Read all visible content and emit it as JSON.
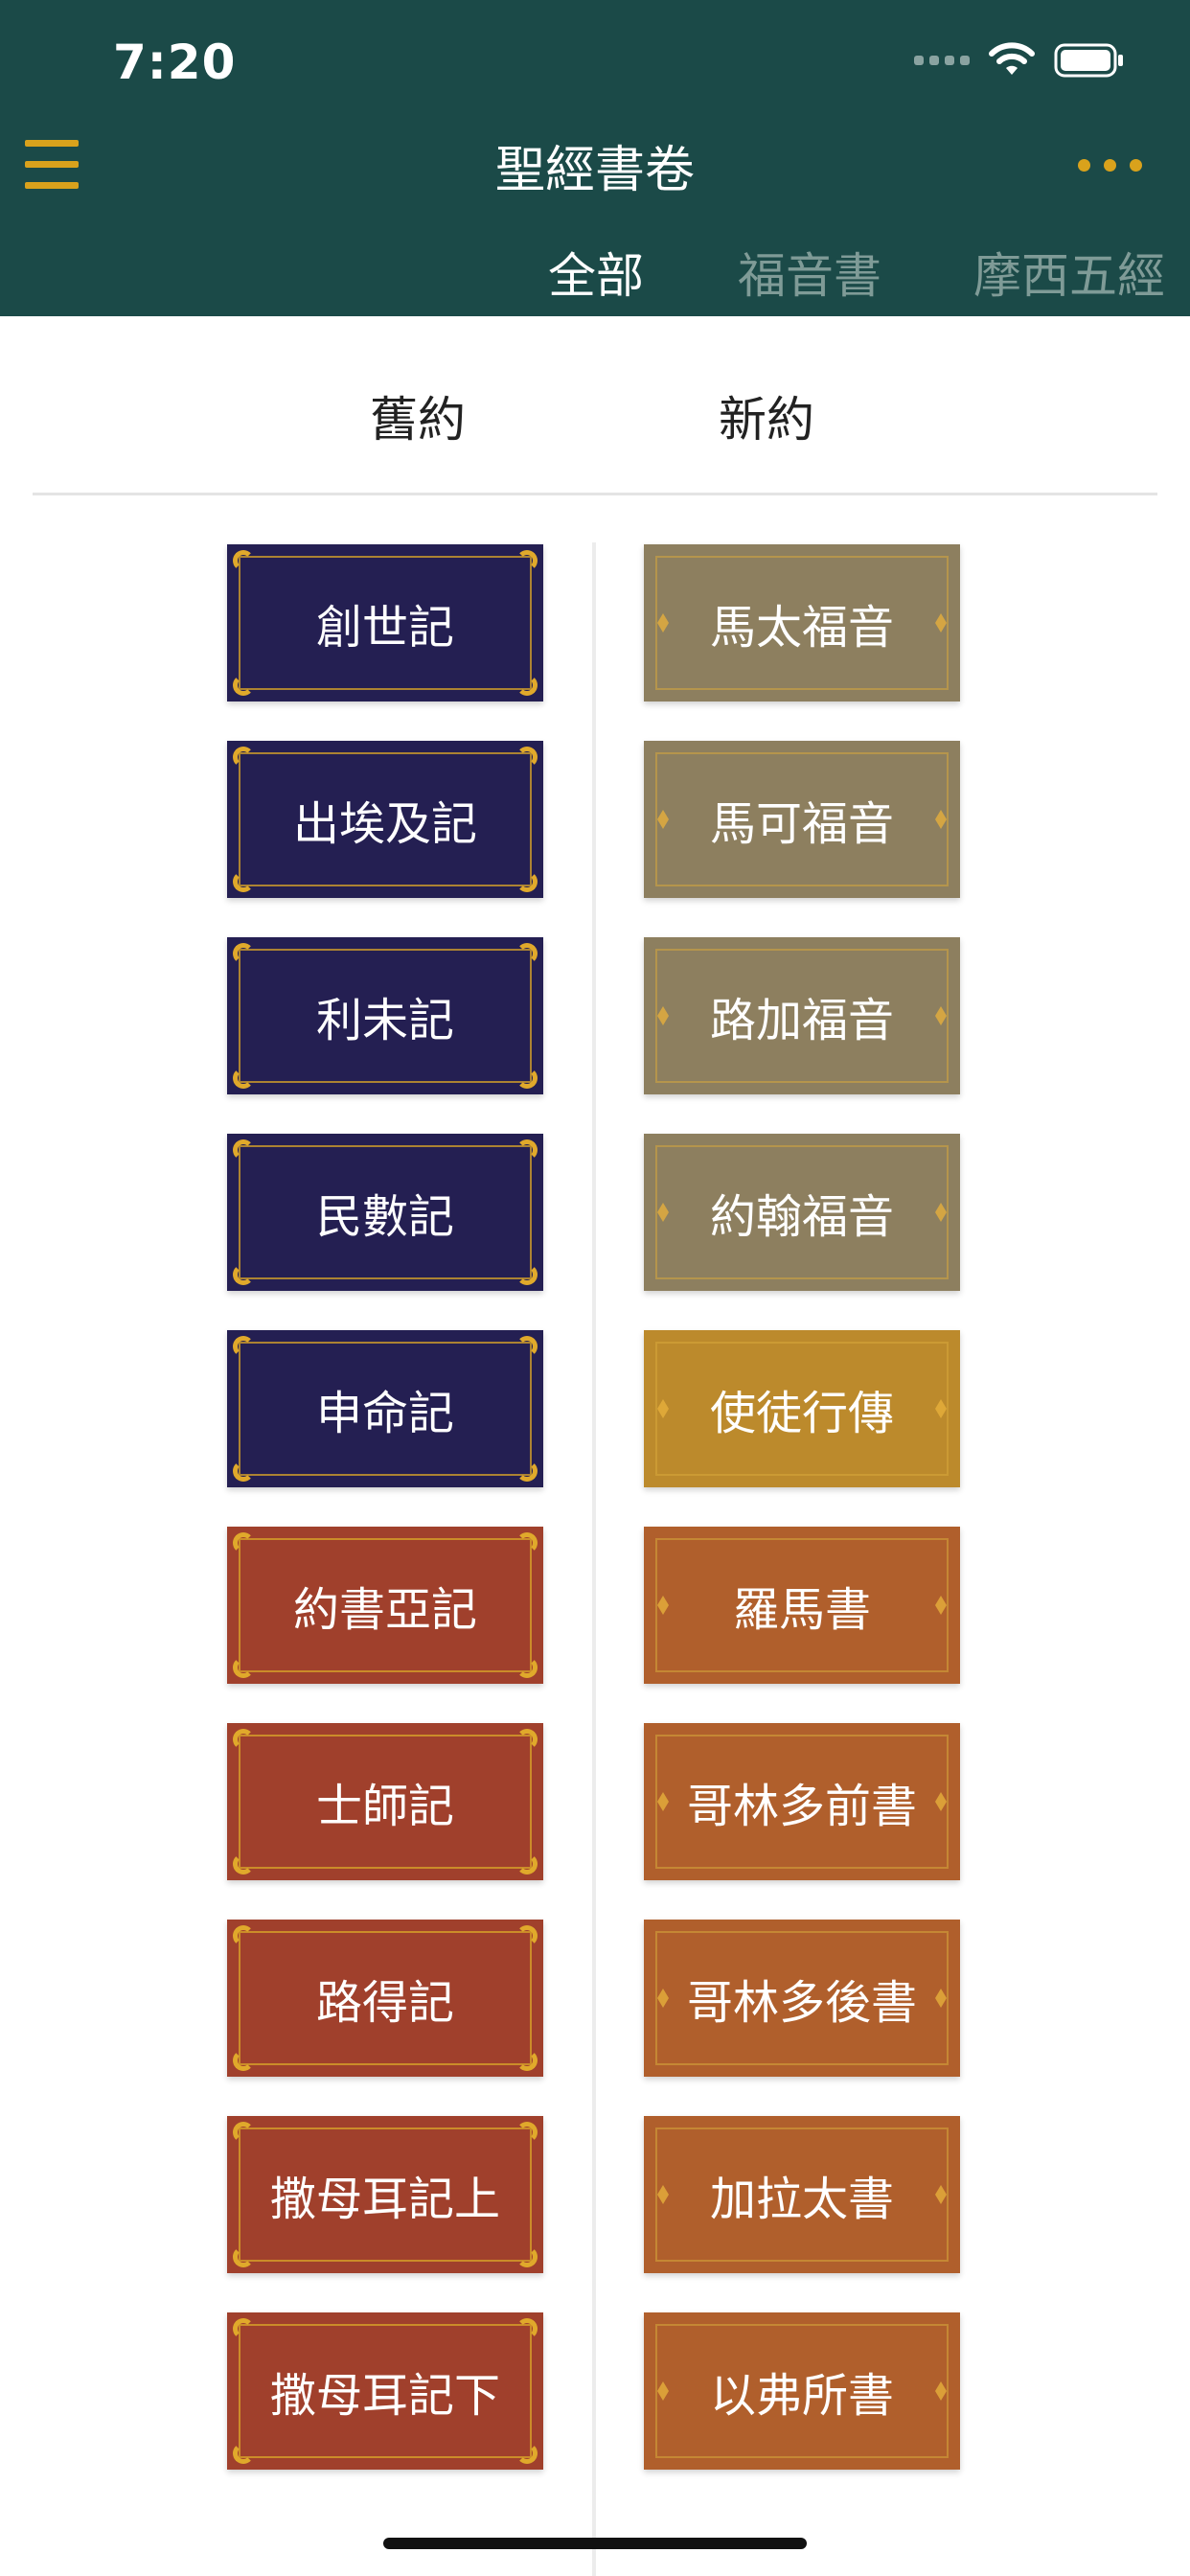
{
  "status": {
    "time": "7:20"
  },
  "header": {
    "title": "聖經書卷",
    "tabs": [
      {
        "label": "全部",
        "active": true
      },
      {
        "label": "福音書",
        "active": false
      },
      {
        "label": "摩西五經",
        "active": false
      }
    ]
  },
  "testament_tabs": {
    "old": "舊約",
    "new": "新約"
  },
  "old_testament": [
    {
      "name": "創世記",
      "color": "#241f52"
    },
    {
      "name": "出埃及記",
      "color": "#241f52"
    },
    {
      "name": "利未記",
      "color": "#241f52"
    },
    {
      "name": "民數記",
      "color": "#241f52"
    },
    {
      "name": "申命記",
      "color": "#241f52"
    },
    {
      "name": "約書亞記",
      "color": "#a0402c"
    },
    {
      "name": "士師記",
      "color": "#a0402c"
    },
    {
      "name": "路得記",
      "color": "#a0402c"
    },
    {
      "name": "撒母耳記上",
      "color": "#a0402c"
    },
    {
      "name": "撒母耳記下",
      "color": "#a0402c"
    }
  ],
  "new_testament": [
    {
      "name": "馬太福音",
      "color": "#8d7f5f"
    },
    {
      "name": "馬可福音",
      "color": "#8d7f5f"
    },
    {
      "name": "路加福音",
      "color": "#8d7f5f"
    },
    {
      "name": "約翰福音",
      "color": "#8d7f5f"
    },
    {
      "name": "使徒行傳",
      "color": "#bc8a2c"
    },
    {
      "name": "羅馬書",
      "color": "#b05f2c"
    },
    {
      "name": "哥林多前書",
      "color": "#b05f2c"
    },
    {
      "name": "哥林多後書",
      "color": "#b05f2c"
    },
    {
      "name": "加拉太書",
      "color": "#b05f2c"
    },
    {
      "name": "以弗所書",
      "color": "#b05f2c"
    }
  ],
  "colors": {
    "header_bg": "#1b4a48",
    "accent": "#d9a21c"
  }
}
